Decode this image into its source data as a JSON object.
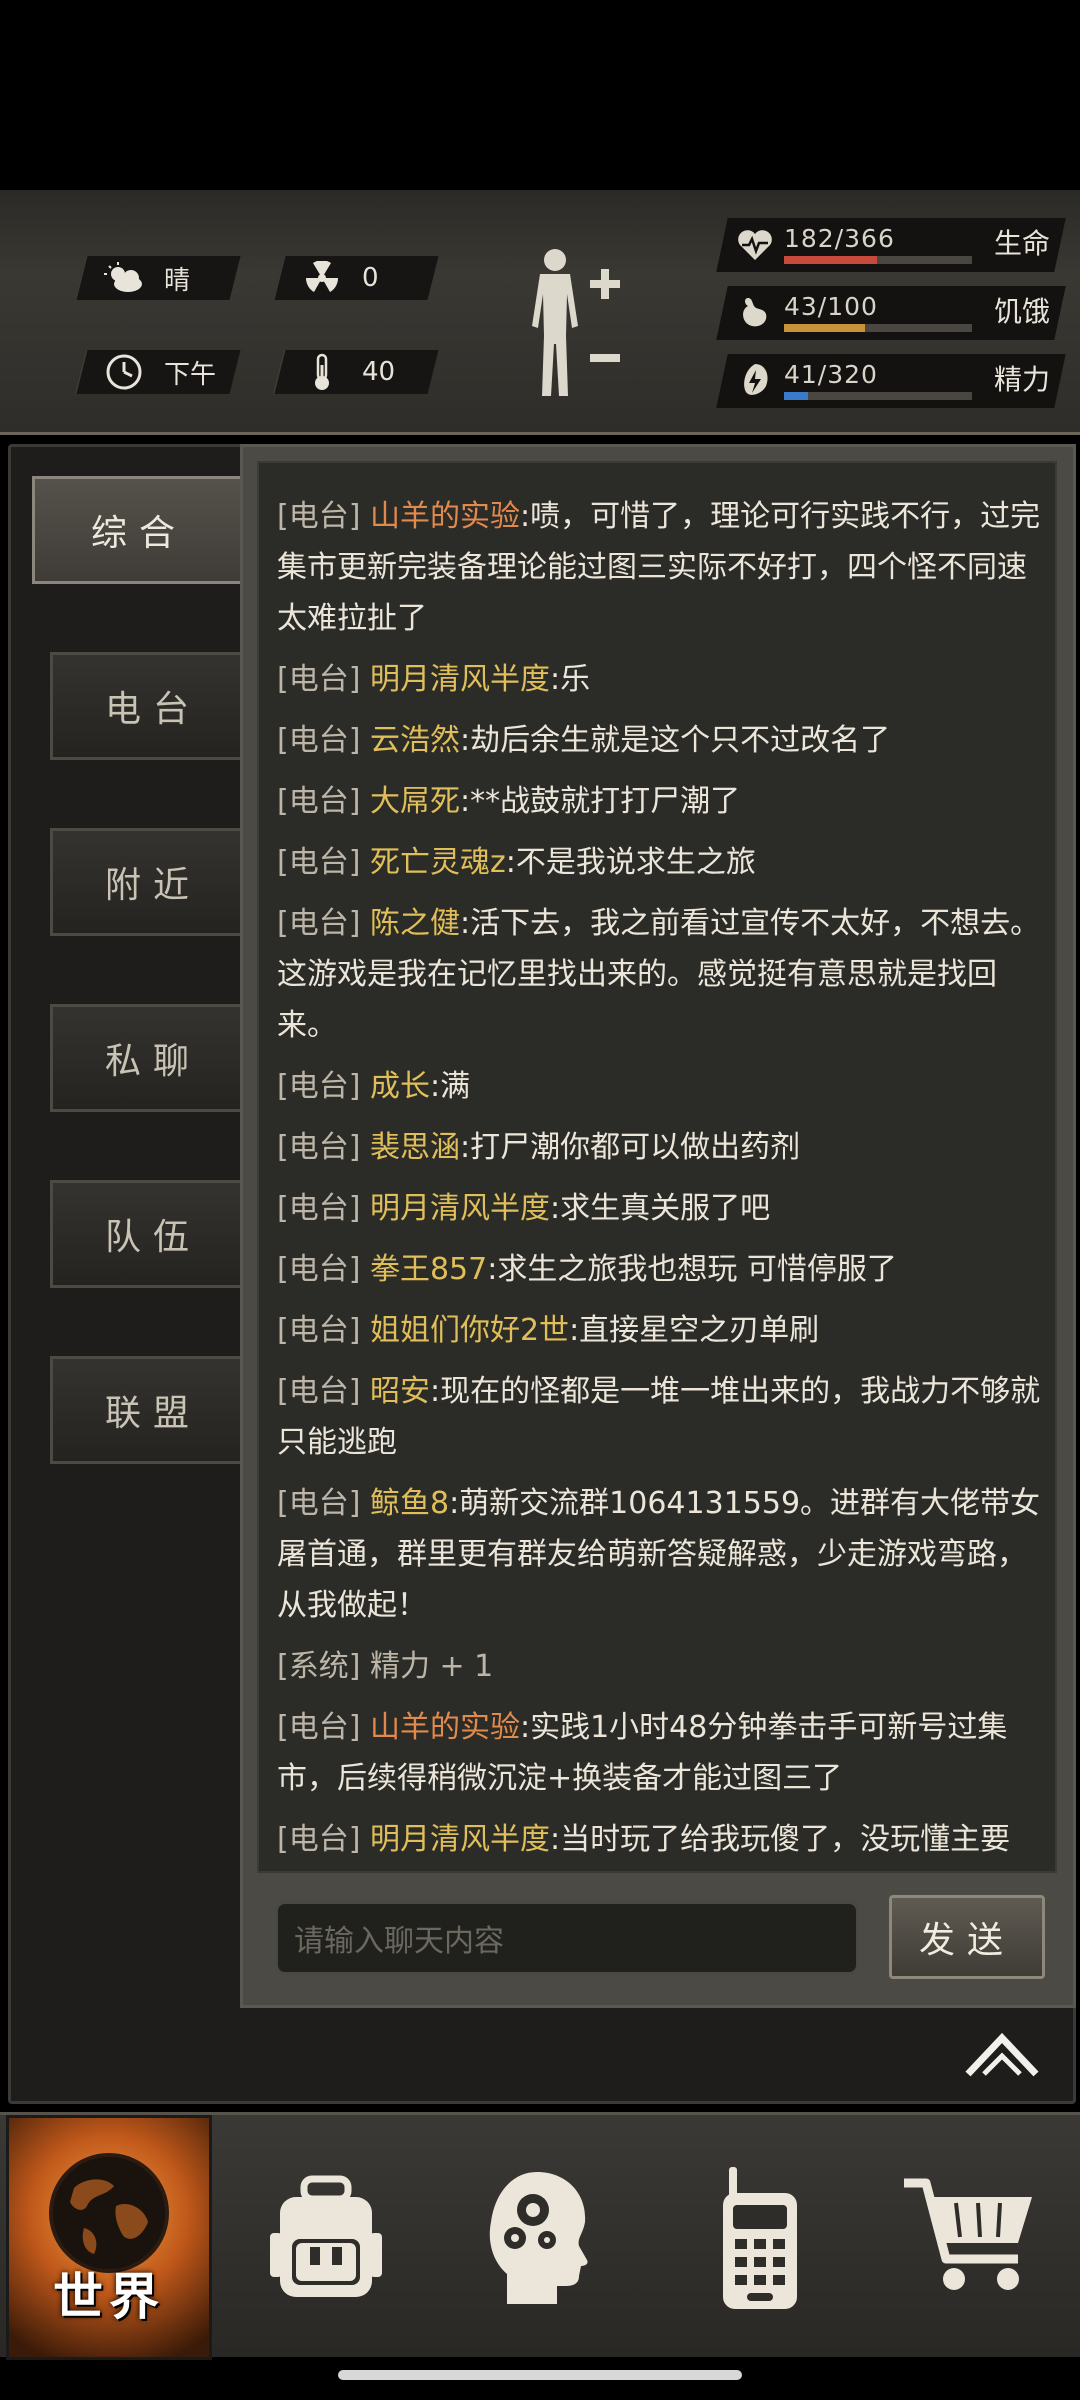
{
  "status": {
    "weather": "晴",
    "radiation": "0",
    "time_of_day": "下午",
    "temperature": "40",
    "stats": [
      {
        "value": "182/366",
        "label": "生命",
        "fill": 0.497,
        "color": "#c84a3a",
        "icon": "heart-pulse-icon"
      },
      {
        "value": "43/100",
        "label": "饥饿",
        "fill": 0.43,
        "color": "#c8923a",
        "icon": "stomach-icon"
      },
      {
        "value": "41/320",
        "label": "精力",
        "fill": 0.128,
        "color": "#3a7ac8",
        "icon": "energy-bolt-icon"
      }
    ]
  },
  "tabs": {
    "general": "综合",
    "radio": "电台",
    "nearby": "附近",
    "private": "私聊",
    "team": "队伍",
    "alliance": "联盟"
  },
  "messages": [
    {
      "channel": "[电台]",
      "name": "山羊的实验",
      "name_color": "orange",
      "text": ":啧，可惜了，理论可行实践不行，过完集市更新完装备理论能过图三实际不好打，四个怪不同速太难拉扯了"
    },
    {
      "channel": "[电台]",
      "name": "明月清风半度",
      "name_color": "yellow",
      "text": ":乐"
    },
    {
      "channel": "[电台]",
      "name": "云浩然",
      "name_color": "yellow",
      "text": ":劫后余生就是这个只不过改名了"
    },
    {
      "channel": "[电台]",
      "name": "大屌死",
      "name_color": "yellow",
      "text": ":**战鼓就打打尸潮了"
    },
    {
      "channel": "[电台]",
      "name": "死亡灵魂z",
      "name_color": "yellow",
      "text": ":不是我说求生之旅"
    },
    {
      "channel": "[电台]",
      "name": "陈之健",
      "name_color": "yellow",
      "text": ":活下去，我之前看过宣传不太好，不想去。这游戏是我在记忆里找出来的。感觉挺有意思就是找回来。"
    },
    {
      "channel": "[电台]",
      "name": "成长",
      "name_color": "yellow",
      "text": ":满"
    },
    {
      "channel": "[电台]",
      "name": "裴思涵",
      "name_color": "yellow",
      "text": ":打尸潮你都可以做出药剂"
    },
    {
      "channel": "[电台]",
      "name": "明月清风半度",
      "name_color": "yellow",
      "text": ":求生真关服了吧"
    },
    {
      "channel": "[电台]",
      "name": "拳王857",
      "name_color": "yellow",
      "text": ":求生之旅我也想玩 可惜停服了"
    },
    {
      "channel": "[电台]",
      "name": "姐姐们你好2世",
      "name_color": "yellow",
      "text": ":直接星空之刃单刷"
    },
    {
      "channel": "[电台]",
      "name": "昭安",
      "name_color": "yellow",
      "text": ":现在的怪都是一堆一堆出来的，我战力不够就只能逃跑"
    },
    {
      "channel": "[电台]",
      "name": "鲸鱼8",
      "name_color": "yellow",
      "text": ":萌新交流群1064131559。进群有大佬带女屠首通，群里更有群友给萌新答疑解惑，少走游戏弯路，从我做起！"
    },
    {
      "channel": "[系统]",
      "name": "",
      "name_color": "",
      "text": "精力 + 1"
    },
    {
      "channel": "[电台]",
      "name": "山羊的实验",
      "name_color": "orange",
      "text": ":实践1小时48分钟拳击手可新号过集市，后续得稍微沉淀+换装备才能过图三了"
    },
    {
      "channel": "[电台]",
      "name": "明月清风半度",
      "name_color": "yellow",
      "text": ":当时玩了给我玩傻了，没玩懂主要"
    }
  ],
  "chat_input": {
    "placeholder": "请输入聊天内容"
  },
  "send_label": "发送",
  "nav": {
    "world": "世界"
  }
}
